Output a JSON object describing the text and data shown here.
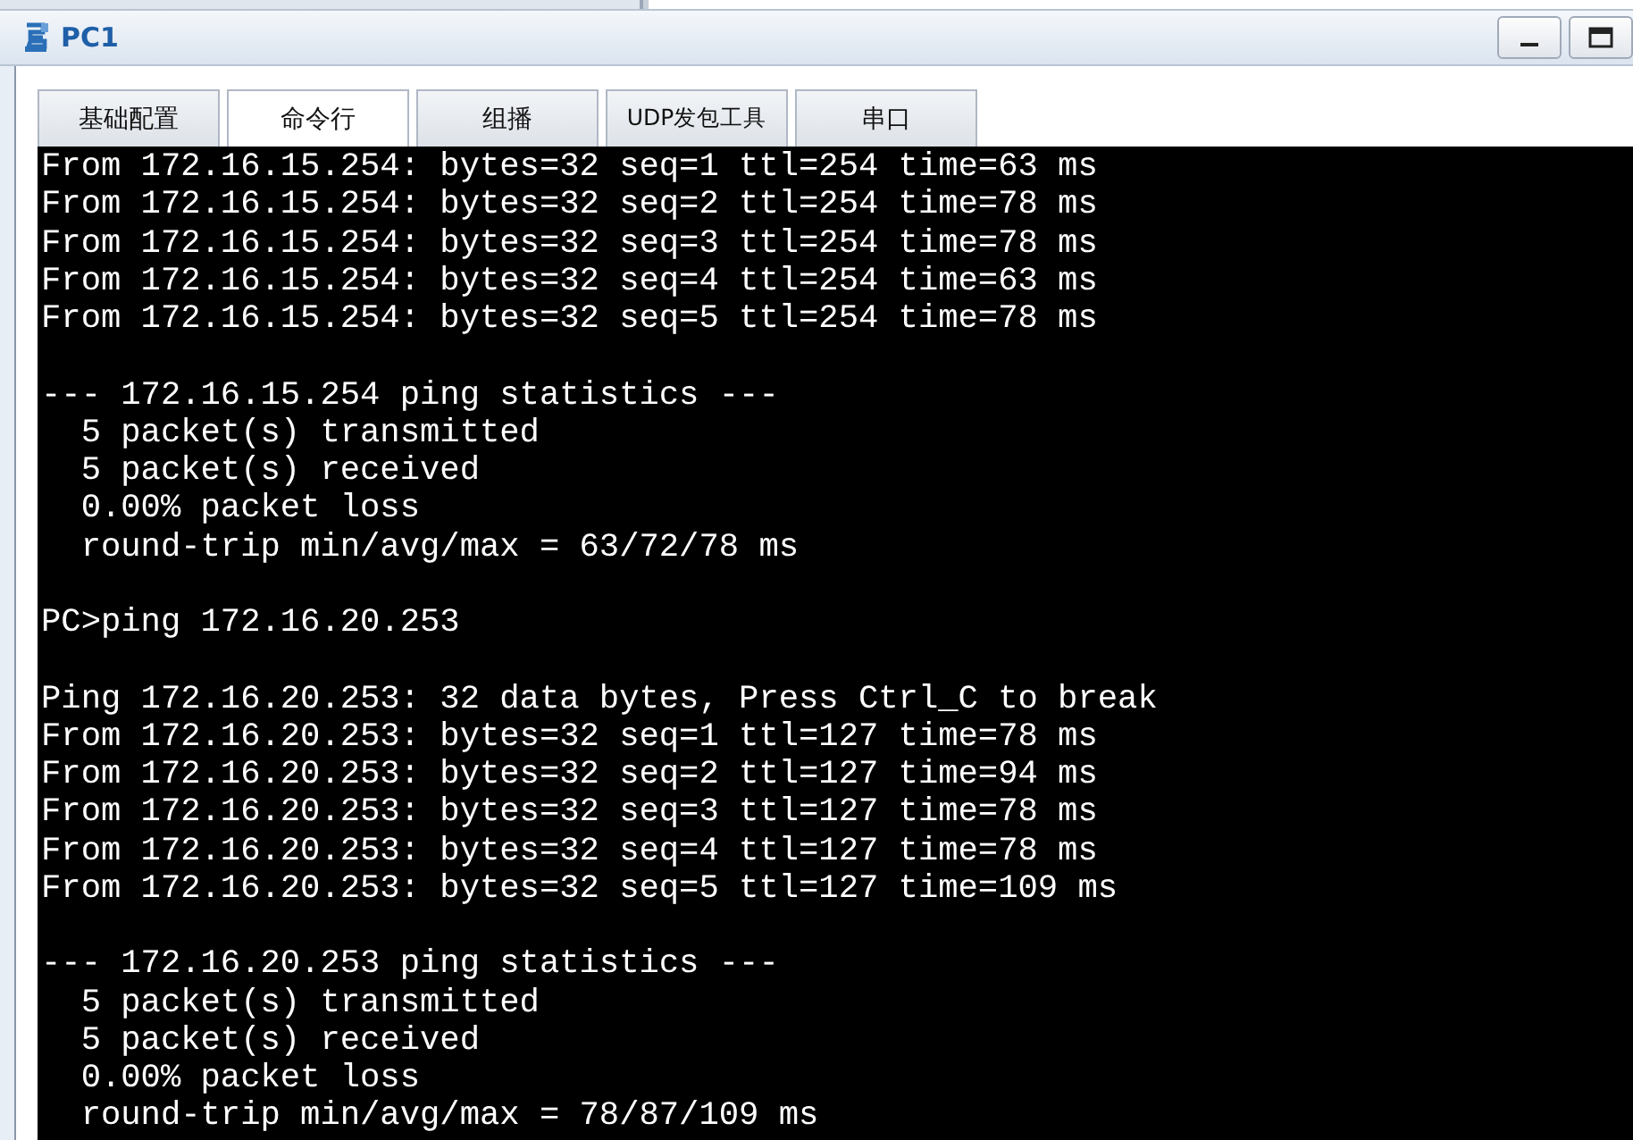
{
  "window": {
    "title": "PC1"
  },
  "tabs": [
    {
      "label": "基础配置",
      "selected": false
    },
    {
      "label": "命令行",
      "selected": true
    },
    {
      "label": "组播",
      "selected": false
    },
    {
      "label": "UDP发包工具",
      "selected": false
    },
    {
      "label": "串口",
      "selected": false
    }
  ],
  "terminal": {
    "blocks": [
      [
        "From 172.16.15.254: bytes=32 seq=1 ttl=254 time=63 ms",
        "From 172.16.15.254: bytes=32 seq=2 ttl=254 time=78 ms",
        "From 172.16.15.254: bytes=32 seq=3 ttl=254 time=78 ms",
        "From 172.16.15.254: bytes=32 seq=4 ttl=254 time=63 ms",
        "From 172.16.15.254: bytes=32 seq=5 ttl=254 time=78 ms"
      ],
      [
        "--- 172.16.15.254 ping statistics ---",
        "  5 packet(s) transmitted",
        "  5 packet(s) received",
        "  0.00% packet loss",
        "  round-trip min/avg/max = 63/72/78 ms"
      ],
      [
        "PC>ping 172.16.20.253"
      ],
      [
        "Ping 172.16.20.253: 32 data bytes, Press Ctrl_C to break",
        "From 172.16.20.253: bytes=32 seq=1 ttl=127 time=78 ms",
        "From 172.16.20.253: bytes=32 seq=2 ttl=127 time=94 ms",
        "From 172.16.20.253: bytes=32 seq=3 ttl=127 time=78 ms",
        "From 172.16.20.253: bytes=32 seq=4 ttl=127 time=78 ms",
        "From 172.16.20.253: bytes=32 seq=5 ttl=127 time=109 ms"
      ],
      [
        "--- 172.16.20.253 ping statistics ---",
        "  5 packet(s) transmitted",
        "  5 packet(s) received",
        "  0.00% packet loss",
        "  round-trip min/avg/max = 78/87/109 ms"
      ]
    ]
  }
}
